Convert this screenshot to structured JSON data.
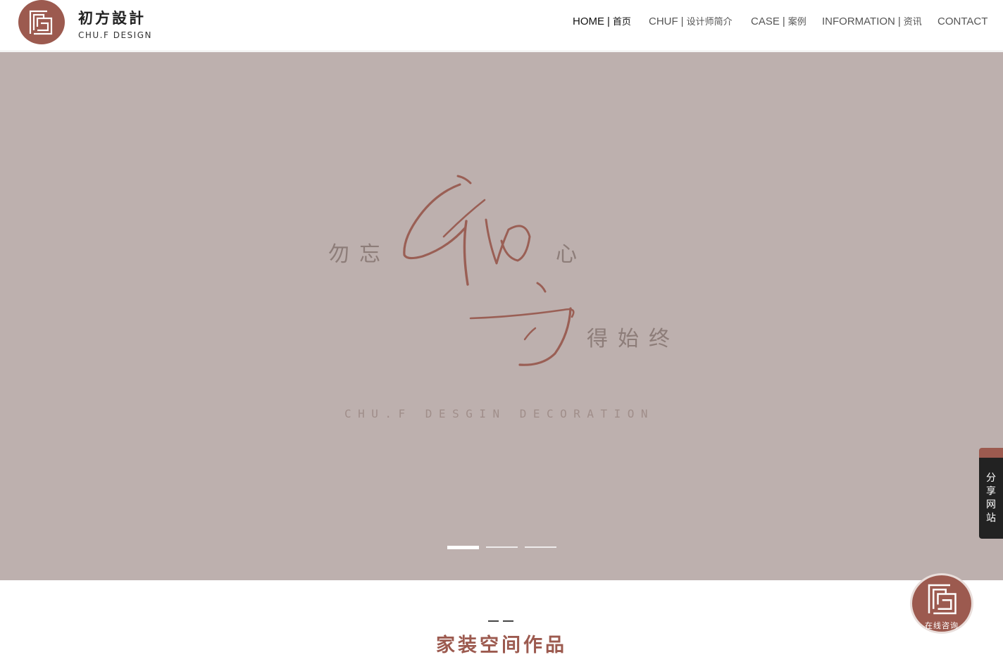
{
  "brand": {
    "name_cn": "初方設計",
    "name_en": "CHU.F DESIGN",
    "accent_color": "#9c5a4f",
    "logo_icon": "square-spiral-logo-icon"
  },
  "nav": {
    "items": [
      {
        "en": "HOME",
        "sep": "|",
        "cn": "首页",
        "active": true
      },
      {
        "en": "CHUF",
        "sep": "|",
        "cn": "设计师简介",
        "active": false
      },
      {
        "en": "CASE",
        "sep": "|",
        "cn": "案例",
        "active": false
      },
      {
        "en": "INFORMATION",
        "sep": "|",
        "cn": "资讯",
        "active": false
      },
      {
        "en": "CONTACT",
        "sep": "",
        "cn": "",
        "active": false
      }
    ]
  },
  "hero": {
    "background_color": "#bdb0ae",
    "slogan_left": "勿忘",
    "slogan_heart": "心",
    "slogan_right": "得始终",
    "calligraphy_text": "初方",
    "brand_line": "CHU.F DESGIN DECORATION",
    "slide_count": 3,
    "active_slide": 1
  },
  "share": {
    "label_chars": [
      "分",
      "享",
      "网",
      "站"
    ]
  },
  "section": {
    "title": "家装空间作品"
  },
  "consult": {
    "label": "在线咨询",
    "icon": "square-spiral-logo-icon"
  }
}
